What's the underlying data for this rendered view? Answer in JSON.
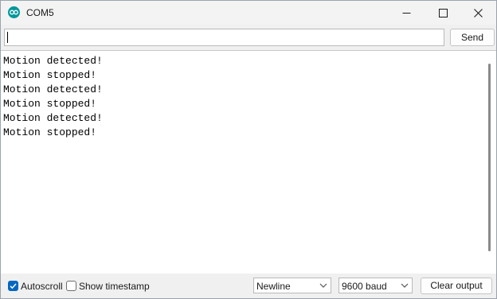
{
  "window": {
    "title": "COM5",
    "app_icon": "arduino-infinity-icon",
    "accent_color": "#00979c"
  },
  "input": {
    "value": "",
    "send_label": "Send"
  },
  "output": {
    "lines": [
      "Motion detected!",
      "Motion stopped!",
      "Motion detected!",
      "Motion stopped!",
      "Motion detected!",
      "Motion stopped!"
    ]
  },
  "footer": {
    "autoscroll": {
      "label": "Autoscroll",
      "checked": true
    },
    "timestamp": {
      "label": "Show timestamp",
      "checked": false
    },
    "line_ending": {
      "selected": "Newline"
    },
    "baud_rate": {
      "selected": "9600 baud"
    },
    "clear_label": "Clear output",
    "checkbox_color": "#0067c0"
  }
}
